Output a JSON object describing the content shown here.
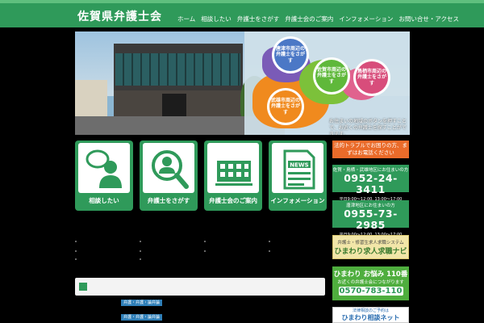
{
  "header": {
    "site_title": "佐賀県弁護士会",
    "nav": [
      "ホーム",
      "相談したい",
      "弁護士をさがす",
      "弁護士会のご案内",
      "インフォメーション",
      "お問い合せ・アクセス"
    ]
  },
  "hero": {
    "bubbles": [
      "唐津市周辺の弁護士をさがす",
      "佐賀市周辺の弁護士をさがす",
      "鳥栖市周辺の弁護士をさがす",
      "武雄市周辺の弁護士をさがす"
    ],
    "note": "お住まいの地域のボタンを押すことで、お近くの弁護士を探すことができます。"
  },
  "cards": [
    {
      "label": "相談したい",
      "icon": "consult-person-icon"
    },
    {
      "label": "弁護士をさがす",
      "icon": "search-person-icon"
    },
    {
      "label": "弁護士会のご案内",
      "icon": "building-icon"
    },
    {
      "label": "インフォメーション",
      "icon": "news-icon"
    }
  ],
  "sidebar": {
    "trouble": "法的トラブルでお困りの方、まずはお電話ください",
    "tel1": {
      "title": "佐賀・鳥栖・武雄地区にお住まいの方",
      "number": "0952-24-3411",
      "hours": "平日9:00〜12:00, 13:00〜17:00"
    },
    "tel2": {
      "title": "唐津地区にお住まいの方",
      "number": "0955-73-2985",
      "hours": "平日9:00〜12:00, 13:00〜17:00"
    },
    "navi": {
      "sub": "弁護士・修習生求人求職システム",
      "main": "ひまわり求人求職ナビ"
    },
    "hotline": {
      "title": "ひまわり お悩み 110番",
      "sub": "お近くの弁護士会につながります",
      "number": "0570-783-110"
    },
    "net": {
      "sub": "法律相談のご予約は",
      "main": "ひまわり相談ネット"
    }
  },
  "content": {
    "tags": [
      "弁護・弁護・論弁論",
      "弁護・弁護・論弁論"
    ]
  },
  "colors": {
    "brand_green": "#2f9a5a",
    "accent_orange": "#ea6b2a"
  }
}
